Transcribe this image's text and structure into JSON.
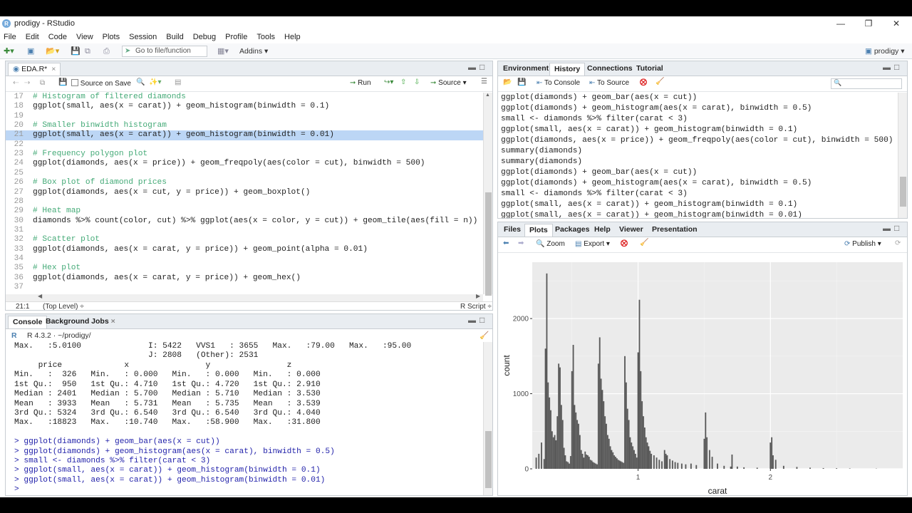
{
  "window": {
    "title": "prodigy - RStudio",
    "logo": "R"
  },
  "menu": [
    "File",
    "Edit",
    "Code",
    "View",
    "Plots",
    "Session",
    "Build",
    "Debug",
    "Profile",
    "Tools",
    "Help"
  ],
  "toolbar": {
    "goto": "Go to file/function",
    "addins": "Addins",
    "project": "prodigy"
  },
  "editor": {
    "tab": "EDA.R*",
    "source_on_save": "Source on Save",
    "run": "Run",
    "source": "Source",
    "lines": [
      {
        "n": "17",
        "t": "# Histogram of filtered diamonds",
        "c": true
      },
      {
        "n": "18",
        "t": "ggplot(small, aes(x = carat)) + geom_histogram(binwidth = 0.1)"
      },
      {
        "n": "19",
        "t": ""
      },
      {
        "n": "20",
        "t": "# Smaller binwidth histogram",
        "c": true
      },
      {
        "n": "21",
        "t": "ggplot(small, aes(x = carat)) + geom_histogram(binwidth = 0.01)",
        "h": true
      },
      {
        "n": "22",
        "t": ""
      },
      {
        "n": "23",
        "t": "# Frequency polygon plot",
        "c": true
      },
      {
        "n": "24",
        "t": "ggplot(diamonds, aes(x = price)) + geom_freqpoly(aes(color = cut), binwidth = 500)"
      },
      {
        "n": "25",
        "t": ""
      },
      {
        "n": "26",
        "t": "# Box plot of diamond prices",
        "c": true
      },
      {
        "n": "27",
        "t": "ggplot(diamonds, aes(x = cut, y = price)) + geom_boxplot()"
      },
      {
        "n": "28",
        "t": ""
      },
      {
        "n": "29",
        "t": "# Heat map",
        "c": true
      },
      {
        "n": "30",
        "t": "diamonds %>% count(color, cut) %>% ggplot(aes(x = color, y = cut)) + geom_tile(aes(fill = n))"
      },
      {
        "n": "31",
        "t": ""
      },
      {
        "n": "32",
        "t": "# Scatter plot",
        "c": true
      },
      {
        "n": "33",
        "t": "ggplot(diamonds, aes(x = carat, y = price)) + geom_point(alpha = 0.01)"
      },
      {
        "n": "34",
        "t": ""
      },
      {
        "n": "35",
        "t": "# Hex plot",
        "c": true
      },
      {
        "n": "36",
        "t": "ggplot(diamonds, aes(x = carat, y = price)) + geom_hex()"
      },
      {
        "n": "37",
        "t": ""
      }
    ],
    "status_pos": "21:1",
    "status_scope": "(Top Level) ÷",
    "status_type": "R Script ÷"
  },
  "console": {
    "tabs": [
      "Console",
      "Background Jobs"
    ],
    "version": "R 4.3.2 · ~/prodigy/",
    "lines": [
      "Max.   :5.0100              I: 5422   VVS1   : 3655   Max.   :79.00   Max.   :95.00",
      "                            J: 2808   (Other): 2531",
      "     price             x                y                z",
      "Min.   :  326   Min.   : 0.000   Min.   : 0.000   Min.   : 0.000",
      "1st Qu.:  950   1st Qu.: 4.710   1st Qu.: 4.720   1st Qu.: 2.910",
      "Median : 2401   Median : 5.700   Median : 5.710   Median : 3.530",
      "Mean   : 3933   Mean   : 5.731   Mean   : 5.735   Mean   : 3.539",
      "3rd Qu.: 5324   3rd Qu.: 6.540   3rd Qu.: 6.540   3rd Qu.: 4.040",
      "Max.   :18823   Max.   :10.740   Max.   :58.900   Max.   :31.800",
      "",
      "> ggplot(diamonds) + geom_bar(aes(x = cut))",
      "> ggplot(diamonds) + geom_histogram(aes(x = carat), binwidth = 0.5)",
      "> small <- diamonds %>% filter(carat < 3)",
      "> ggplot(small, aes(x = carat)) + geom_histogram(binwidth = 0.1)",
      "> ggplot(small, aes(x = carat)) + geom_histogram(binwidth = 0.01)",
      "> "
    ]
  },
  "env": {
    "tabs": [
      "Environment",
      "History",
      "Connections",
      "Tutorial"
    ],
    "to_console": "To Console",
    "to_source": "To Source",
    "history": [
      "ggplot(diamonds) + geom_bar(aes(x = cut))",
      "ggplot(diamonds) + geom_histogram(aes(x = carat), binwidth = 0.5)",
      "small <- diamonds %>% filter(carat < 3)",
      "ggplot(small, aes(x = carat)) + geom_histogram(binwidth = 0.1)",
      "ggplot(diamonds, aes(x = price)) + geom_freqpoly(aes(color = cut), binwidth = 500)",
      "summary(diamonds)",
      "summary(diamonds)",
      "ggplot(diamonds) + geom_bar(aes(x = cut))",
      "ggplot(diamonds) + geom_histogram(aes(x = carat), binwidth = 0.5)",
      "small <- diamonds %>% filter(carat < 3)",
      "ggplot(small, aes(x = carat)) + geom_histogram(binwidth = 0.1)",
      "ggplot(small, aes(x = carat)) + geom_histogram(binwidth = 0.01)"
    ]
  },
  "plots": {
    "tabs": [
      "Files",
      "Plots",
      "Packages",
      "Help",
      "Viewer",
      "Presentation"
    ],
    "zoom": "Zoom",
    "export": "Export",
    "publish": "Publish"
  },
  "chart_data": {
    "type": "bar",
    "xlabel": "carat",
    "ylabel": "count",
    "xlim": [
      0.2,
      3.0
    ],
    "ylim": [
      0,
      2750
    ],
    "xticks": [
      1,
      2
    ],
    "yticks": [
      0,
      1000,
      2000
    ],
    "x": [
      0.23,
      0.25,
      0.27,
      0.29,
      0.3,
      0.31,
      0.32,
      0.33,
      0.34,
      0.35,
      0.36,
      0.37,
      0.38,
      0.39,
      0.4,
      0.41,
      0.42,
      0.43,
      0.44,
      0.45,
      0.46,
      0.47,
      0.48,
      0.49,
      0.5,
      0.51,
      0.52,
      0.53,
      0.54,
      0.55,
      0.56,
      0.57,
      0.58,
      0.59,
      0.6,
      0.61,
      0.62,
      0.63,
      0.64,
      0.65,
      0.66,
      0.67,
      0.68,
      0.69,
      0.7,
      0.71,
      0.72,
      0.73,
      0.74,
      0.75,
      0.76,
      0.77,
      0.78,
      0.79,
      0.8,
      0.81,
      0.82,
      0.83,
      0.84,
      0.85,
      0.86,
      0.87,
      0.88,
      0.89,
      0.9,
      0.91,
      0.92,
      0.93,
      0.94,
      0.95,
      0.96,
      0.97,
      0.98,
      0.99,
      1.0,
      1.01,
      1.02,
      1.03,
      1.04,
      1.05,
      1.06,
      1.07,
      1.08,
      1.09,
      1.1,
      1.12,
      1.14,
      1.16,
      1.18,
      1.2,
      1.21,
      1.22,
      1.24,
      1.26,
      1.28,
      1.3,
      1.33,
      1.36,
      1.4,
      1.44,
      1.5,
      1.51,
      1.52,
      1.54,
      1.56,
      1.6,
      1.65,
      1.7,
      1.71,
      1.75,
      1.8,
      1.9,
      2.0,
      2.01,
      2.02,
      2.04,
      2.1,
      2.2,
      2.3,
      2.4,
      2.5,
      2.6,
      2.8
    ],
    "values": [
      150,
      200,
      350,
      130,
      1600,
      2600,
      1150,
      950,
      780,
      500,
      420,
      450,
      380,
      700,
      1400,
      1350,
      850,
      650,
      280,
      180,
      100,
      90,
      70,
      170,
      1300,
      1650,
      850,
      750,
      650,
      600,
      450,
      250,
      200,
      150,
      230,
      190,
      180,
      160,
      120,
      110,
      90,
      80,
      70,
      60,
      1400,
      1750,
      1200,
      1050,
      900,
      700,
      600,
      450,
      400,
      300,
      250,
      220,
      180,
      160,
      140,
      120,
      110,
      100,
      90,
      80,
      1500,
      1150,
      800,
      650,
      420,
      350,
      300,
      250,
      200,
      150,
      1550,
      2250,
      1300,
      900,
      700,
      550,
      420,
      350,
      300,
      240,
      200,
      180,
      150,
      120,
      100,
      250,
      200,
      180,
      130,
      110,
      90,
      80,
      70,
      60,
      70,
      50,
      400,
      750,
      420,
      250,
      160,
      70,
      40,
      30,
      190,
      30,
      20,
      15,
      350,
      420,
      180,
      120,
      40,
      25,
      15,
      10,
      8,
      5,
      3
    ]
  }
}
